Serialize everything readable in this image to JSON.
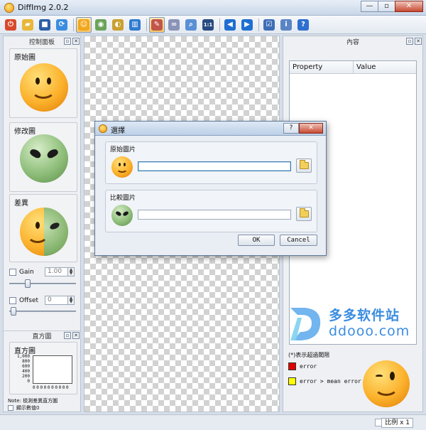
{
  "window": {
    "title": "DiffImg 2.0.2",
    "minimize": "—",
    "maximize": "▫",
    "close": "✕"
  },
  "toolbar": [
    {
      "name": "exit",
      "color": "#d8492b",
      "glyph": "⏻"
    },
    {
      "name": "open-folder",
      "color": "#e8b83a",
      "glyph": "▰"
    },
    {
      "name": "save",
      "color": "#2c5fa8",
      "glyph": "■"
    },
    {
      "name": "refresh",
      "color": "#3b8de0",
      "glyph": "⟳"
    },
    {
      "name": "original-image",
      "color": "#f2a71e",
      "glyph": "☺"
    },
    {
      "name": "modified-image",
      "color": "#6aa35a",
      "glyph": "◉"
    },
    {
      "name": "difference-image",
      "color": "#c9a031",
      "glyph": "◐"
    },
    {
      "name": "split-view",
      "color": "#2f7ad1",
      "glyph": "▥"
    },
    {
      "name": "analyze",
      "color": "#c2564a",
      "glyph": "✎"
    },
    {
      "name": "link",
      "color": "#8a94b8",
      "glyph": "∞"
    },
    {
      "name": "zoom",
      "color": "#5a8fd6",
      "glyph": "⌕"
    },
    {
      "name": "actual-size",
      "color": "#294c80",
      "glyph": "1:1"
    },
    {
      "name": "previous",
      "color": "#1f6fd1",
      "glyph": "◀"
    },
    {
      "name": "next",
      "color": "#1f6fd1",
      "glyph": "▶"
    },
    {
      "name": "checklist",
      "color": "#3d6db8",
      "glyph": "☑"
    },
    {
      "name": "info",
      "color": "#5a85c4",
      "glyph": "i"
    },
    {
      "name": "help",
      "color": "#2f6fcf",
      "glyph": "?"
    }
  ],
  "left_panel": {
    "title": "控制面板",
    "original_label": "原始圖",
    "modified_label": "修改圖",
    "difference_label": "差異",
    "gain_label": "Gain",
    "gain_value": "1.00",
    "offset_label": "Offset",
    "offset_value": "0"
  },
  "histogram_panel": {
    "title": "直方圖",
    "group_label": "直方圖",
    "y_labels": [
      "1,000",
      "800",
      "600",
      "400",
      "200",
      "0"
    ],
    "x_labels": "0 0 0 0 0 0 0 0 0 0",
    "note": "Note: 檢測差異直方圖",
    "show_values_label": "顯示數值0"
  },
  "right_panel": {
    "title": "內容",
    "columns": [
      "Property",
      "Value"
    ],
    "legend_note": "(*)表示超過閾限",
    "legend": [
      {
        "color": "#e00000",
        "label": "error"
      },
      {
        "color": "#ffff00",
        "label": "error > mean error"
      }
    ]
  },
  "watermark": {
    "cn": "多多软件站",
    "en": "ddooo.com"
  },
  "statusbar": {
    "scale": "比例 x 1"
  },
  "dialog": {
    "title": "選擇",
    "help": "?",
    "close": "✕",
    "original_group": "原始圖片",
    "compare_group": "比較圖片",
    "ok": "OK",
    "cancel": "Cancel"
  }
}
